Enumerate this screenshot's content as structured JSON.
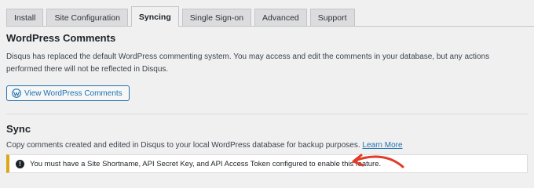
{
  "tabs": [
    {
      "label": "Install"
    },
    {
      "label": "Site Configuration"
    },
    {
      "label": "Syncing",
      "active": true
    },
    {
      "label": "Single Sign-on"
    },
    {
      "label": "Advanced"
    },
    {
      "label": "Support"
    }
  ],
  "comments": {
    "title": "WordPress Comments",
    "description": "Disqus has replaced the default WordPress commenting system. You may access and edit the comments in your database, but any actions performed there will not be reflected in Disqus.",
    "button_label": "View WordPress Comments"
  },
  "sync": {
    "title": "Sync",
    "description": "Copy comments created and edited in Disqus to your local WordPress database for backup purposes.",
    "learn_more": "Learn More",
    "notice": "You must have a Site Shortname, API Secret Key, and API Access Token configured to enable this feature."
  },
  "icons": {
    "wordpress": "wordpress-logo-icon",
    "notice": "exclamation-circle-icon",
    "annotation": "red-arrow-annotation"
  },
  "colors": {
    "accent": "#2271b1",
    "warning_border": "#dba617",
    "annotation": "#e23a26"
  }
}
